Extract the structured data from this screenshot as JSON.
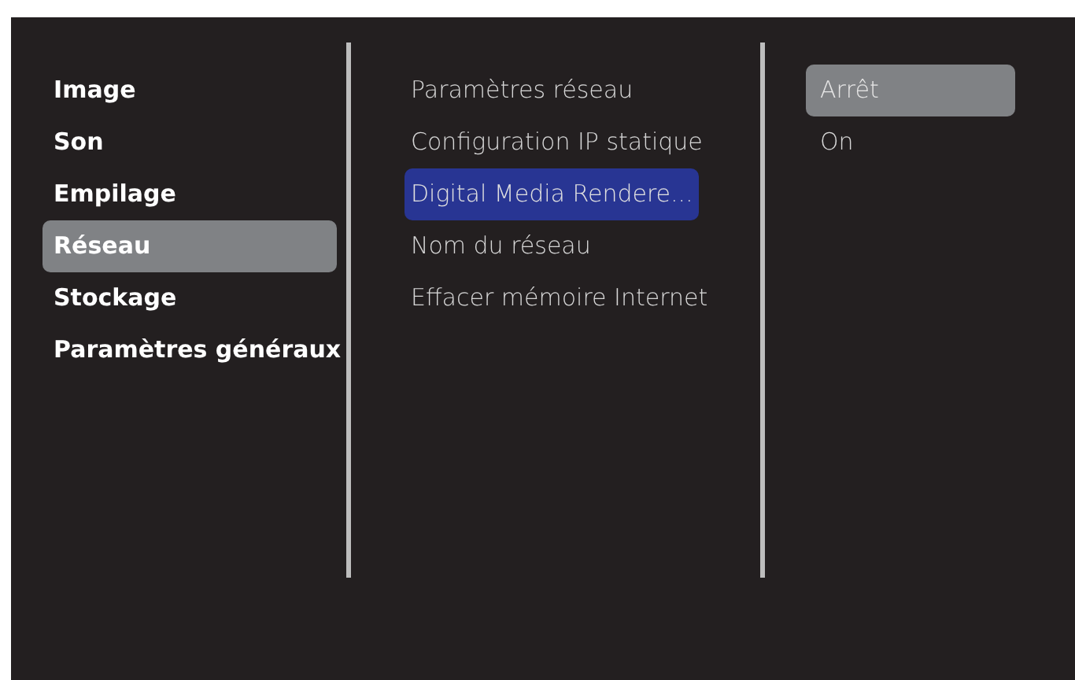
{
  "categories": [
    {
      "label": "Image",
      "selected": false
    },
    {
      "label": "Son",
      "selected": false
    },
    {
      "label": "Empilage",
      "selected": false
    },
    {
      "label": "Réseau",
      "selected": true
    },
    {
      "label": "Stockage",
      "selected": false
    },
    {
      "label": "Paramètres généraux",
      "selected": false
    }
  ],
  "settings": [
    {
      "label": "Paramètres réseau",
      "selected": false
    },
    {
      "label": "Configuration IP statique",
      "selected": false
    },
    {
      "label": "Digital Media Rendere...",
      "selected": true
    },
    {
      "label": "Nom du réseau",
      "selected": false
    },
    {
      "label": "Effacer mémoire Internet",
      "selected": false
    }
  ],
  "options": [
    {
      "label": "Arrêt",
      "selected": true
    },
    {
      "label": "On",
      "selected": false
    }
  ]
}
